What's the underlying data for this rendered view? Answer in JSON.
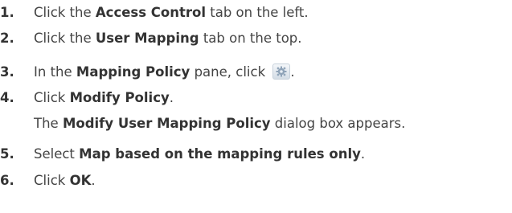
{
  "steps": [
    {
      "num": "1.",
      "pre": "Click the ",
      "bold": "Access Control",
      "post": " tab on the left."
    },
    {
      "num": "2.",
      "pre": "Click the ",
      "bold": "User Mapping",
      "post": " tab on the top."
    },
    {
      "num": "3.",
      "pre": "In the ",
      "bold": "Mapping Policy",
      "post": " pane, click ",
      "icon": "gear-icon",
      "after_icon": "."
    },
    {
      "num": "4.",
      "pre": "Click ",
      "bold": "Modify Policy",
      "post": "."
    },
    {
      "note_pre": "The ",
      "note_bold": "Modify User Mapping Policy",
      "note_post": " dialog box appears."
    },
    {
      "num": "5.",
      "pre": "Select ",
      "bold": "Map based on the mapping rules only",
      "post": "."
    },
    {
      "num": "6.",
      "pre": "Click ",
      "bold": "OK",
      "post": "."
    }
  ]
}
